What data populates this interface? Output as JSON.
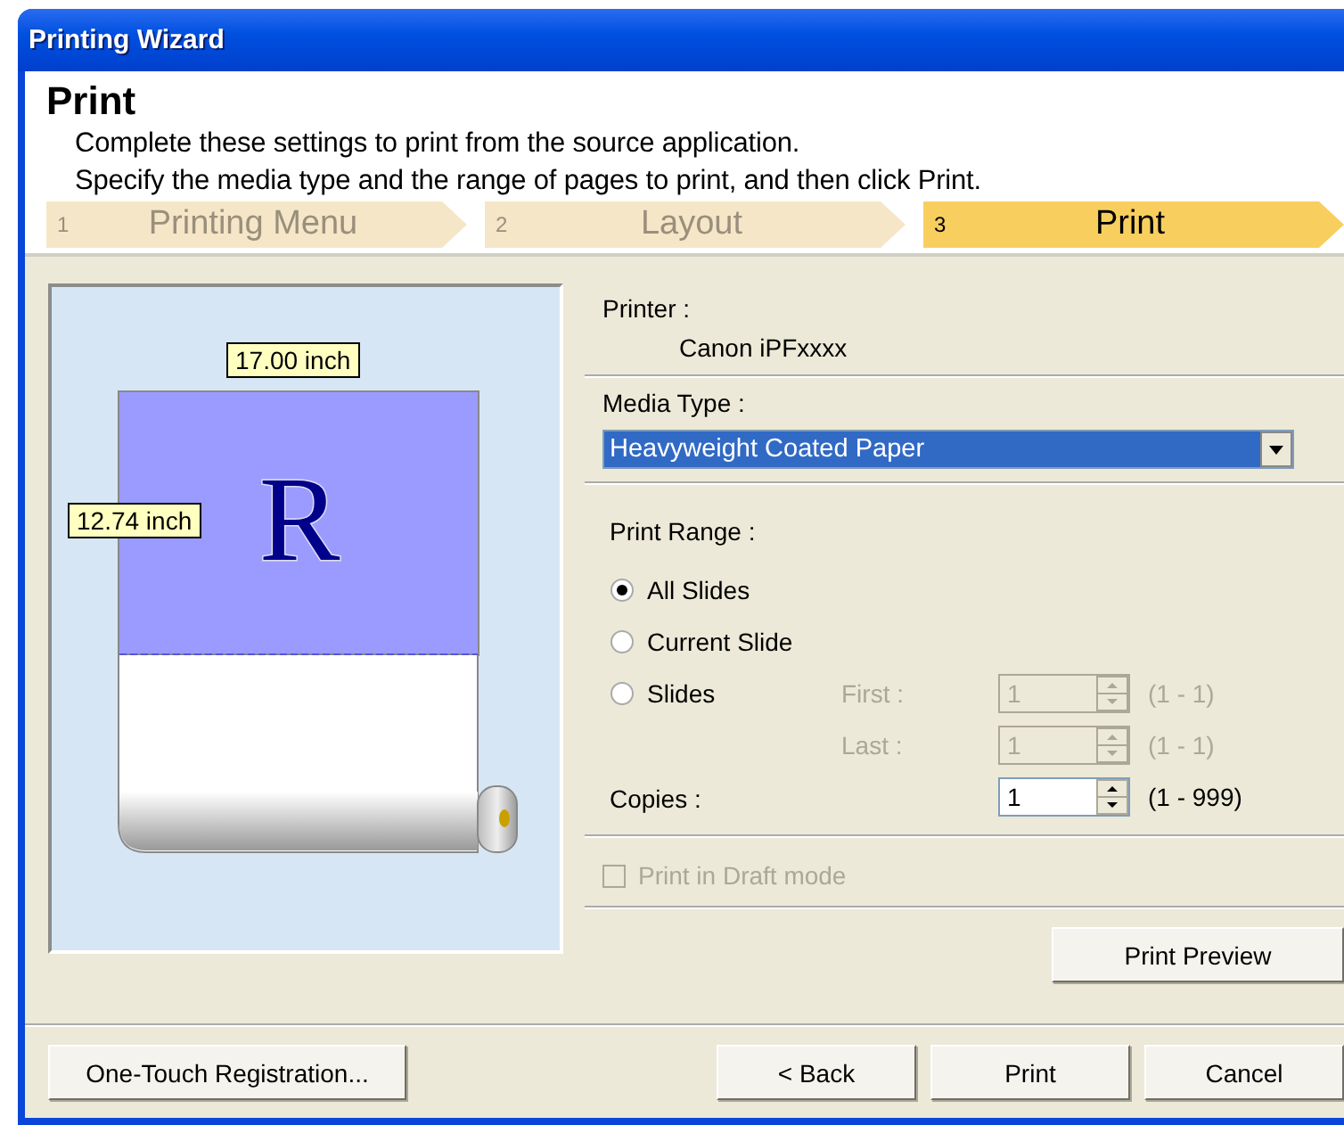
{
  "window": {
    "title": "Printing Wizard"
  },
  "header": {
    "title": "Print",
    "lines": [
      "Complete these settings to print from the source application.",
      "Specify the media type and the range of pages to print, and then click Print."
    ]
  },
  "steps": [
    {
      "number": "1",
      "label": "Printing Menu",
      "selected": false
    },
    {
      "number": "2",
      "label": "Layout",
      "selected": false
    },
    {
      "number": "3",
      "label": "Print",
      "selected": true
    }
  ],
  "preview": {
    "width_label": "17.00 inch",
    "height_label": "12.74 inch",
    "letter": "R"
  },
  "printer": {
    "label": "Printer :",
    "value": "Canon iPFxxxx"
  },
  "media_type": {
    "label": "Media Type :",
    "value": "Heavyweight Coated Paper"
  },
  "print_range": {
    "label": "Print Range :",
    "options": [
      {
        "label": "All Slides",
        "selected": true
      },
      {
        "label": "Current Slide",
        "selected": false
      },
      {
        "label": "Slides",
        "selected": false
      }
    ],
    "spinners": [
      {
        "label": "First :",
        "value": "1",
        "range": "(1 - 1)",
        "disabled": true
      },
      {
        "label": "Last :",
        "value": "1",
        "range": "(1 - 1)",
        "disabled": true
      }
    ]
  },
  "copies": {
    "label": "Copies :",
    "value": "1",
    "range": "(1 - 999)",
    "disabled": false
  },
  "draft": {
    "label": "Print in Draft mode",
    "checked": false,
    "disabled": true
  },
  "print_preview_button": "Print Preview",
  "footer": {
    "left_button": "One-Touch Registration...",
    "buttons": [
      "< Back",
      "Print",
      "Cancel"
    ]
  }
}
